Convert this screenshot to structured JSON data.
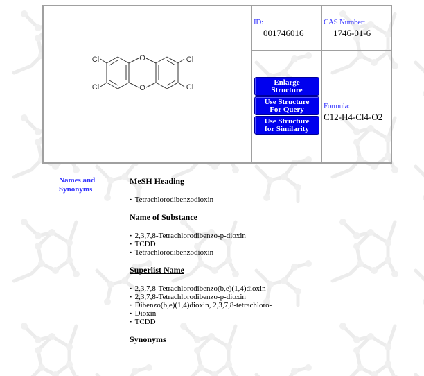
{
  "compound": {
    "id_label": "ID:",
    "id_value": "001746016",
    "cas_label": "CAS Number:",
    "cas_value": "1746-01-6",
    "formula_label": "Formula:",
    "formula_value": "C12-H4-Cl4-O2",
    "structure": {
      "name": "2,3,7,8-Tetrachlorodibenzo-p-dioxin",
      "atom_labels": {
        "chlorine": "Cl",
        "oxygen": "O"
      }
    }
  },
  "buttons": {
    "enlarge": [
      "Enlarge",
      "Structure"
    ],
    "query": [
      "Use Structure",
      "For Query"
    ],
    "similarity": [
      "Use Structure",
      "for Similarity"
    ]
  },
  "side_label": [
    "Names and",
    "Synonyms"
  ],
  "sections": [
    {
      "title": "MeSH Heading",
      "items": [
        "Tetrachlorodibenzodioxin"
      ]
    },
    {
      "title": "Name of Substance",
      "items": [
        "2,3,7,8-Tetrachlorodibenzo-p-dioxin",
        "TCDD",
        "Tetrachlorodibenzodioxin"
      ]
    },
    {
      "title": "Superlist Name",
      "items": [
        "2,3,7,8-Tetrachlorodibenzo(b,e)(1,4)dioxin",
        "2,3,7,8-Tetrachlorodibenzo-p-dioxin",
        "Dibenzo(b,e)(1,4)dioxin, 2,3,7,8-tetrachloro-",
        "Dioxin",
        "TCDD"
      ]
    },
    {
      "title": "Synonyms",
      "items": []
    }
  ],
  "colors": {
    "label_blue": "#3333ff",
    "button_blue": "#0000ee",
    "border_gray": "#a0a0a0",
    "watermark_gray": "#ececec"
  }
}
